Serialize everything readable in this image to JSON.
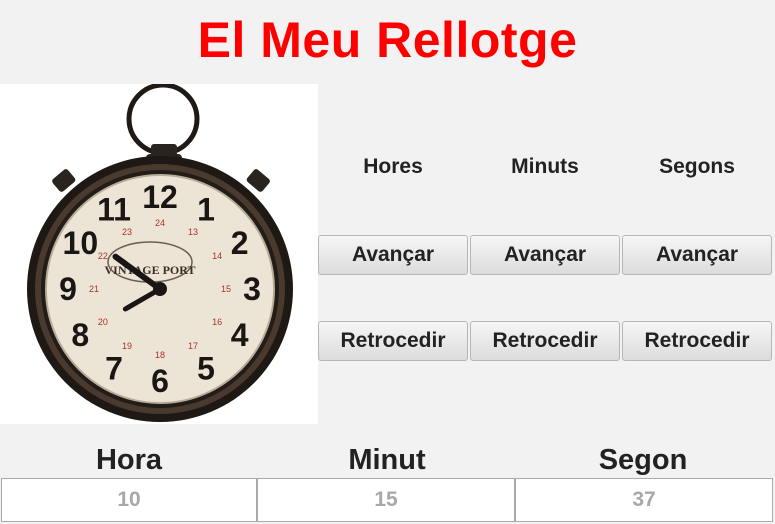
{
  "title": "El Meu Rellotge",
  "clock_image": {
    "numerals": [
      "12",
      "1",
      "2",
      "3",
      "4",
      "5",
      "6",
      "7",
      "8",
      "9",
      "10",
      "11"
    ],
    "inner_numerals": [
      "24",
      "13",
      "14",
      "15",
      "16",
      "17",
      "18",
      "19",
      "20",
      "21",
      "22",
      "23"
    ],
    "brand_text": "VINTAGE PORT",
    "hour_hand_points_to": 10.2,
    "minute_hand_points_to": 8
  },
  "columns": [
    {
      "label": "Hores",
      "advance": "Avançar",
      "back": "Retrocedir"
    },
    {
      "label": "Minuts",
      "advance": "Avançar",
      "back": "Retrocedir"
    },
    {
      "label": "Segons",
      "advance": "Avançar",
      "back": "Retrocedir"
    }
  ],
  "display": [
    {
      "label": "Hora",
      "value": "10"
    },
    {
      "label": "Minut",
      "value": "15"
    },
    {
      "label": "Segon",
      "value": "37"
    }
  ],
  "colors": {
    "title": "#ff0000",
    "value_text": "#a8a8a8"
  }
}
